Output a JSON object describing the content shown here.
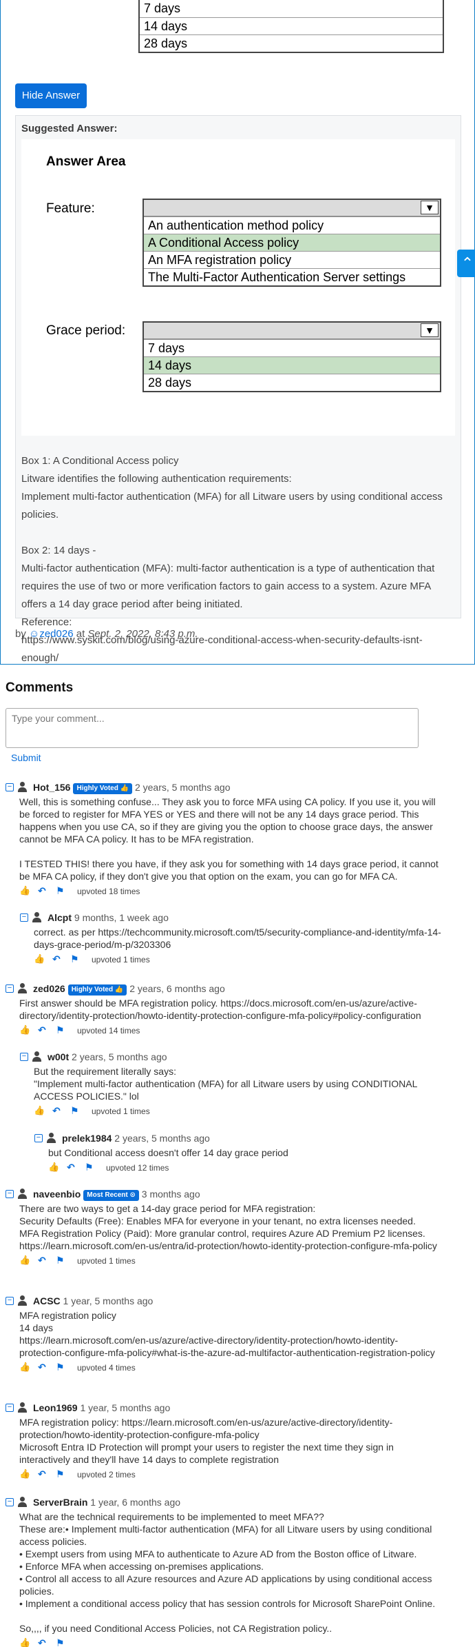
{
  "question": {
    "top_options": [
      "7 days",
      "14 days",
      "28 days"
    ],
    "hide_answer_label": "Hide Answer",
    "suggested_answer_label": "Suggested Answer:",
    "answer_area": {
      "title": "Answer Area",
      "feature_label": "Feature:",
      "feature_options": [
        "An authentication method policy",
        "A Conditional Access policy",
        "An MFA registration policy",
        "The Multi-Factor Authentication Server settings"
      ],
      "feature_selected": "A Conditional Access policy",
      "grace_label": "Grace period:",
      "grace_options": [
        "7 days",
        "14 days",
        "28 days"
      ],
      "grace_selected": "14 days"
    },
    "explanation": [
      "Box 1: A Conditional Access policy",
      "Litware identifies the following authentication requirements:",
      "Implement multi-factor authentication (MFA) for all Litware users by using conditional access policies.",
      "",
      "Box 2: 14 days -",
      "Multi-factor authentication (MFA): multi-factor authentication is a type of authentication that requires the use of two or more verification factors to gain access to a system. Azure MFA offers a 14 day grace period after being initiated.",
      "Reference:",
      "https://www.syskit.com/blog/using-azure-conditional-access-when-security-defaults-isnt-enough/"
    ],
    "byline": {
      "by": "by",
      "user": "zed026",
      "at": "at",
      "date": "Sept. 2, 2022, 8:43 p.m."
    }
  },
  "comments_section": {
    "heading": "Comments",
    "placeholder": "Type your comment...",
    "submit_label": "Submit"
  },
  "comments": [
    {
      "user": "Hot_156",
      "badge": "Highly Voted",
      "time": "2 years, 5 months ago",
      "body": [
        "Well, this is something confuse... They ask you to force MFA using CA policy. If you use it, you will be forced to register for MFA YES or YES and there will not be any 14 days grace period. This happens when you use CA, so if they are giving you the option to choose grace days, the answer cannot be MFA CA policy. It has to be MFA registration.",
        "",
        "I TESTED THIS! there you have, if they ask you for something with 14 days grace period, it cannot be MFA CA policy, if they don't give you that option on the exam, you can go for MFA CA."
      ],
      "upvoted": "upvoted 18 times"
    },
    {
      "user": "Alcpt",
      "badge": "",
      "time": "9 months, 1 week ago",
      "body": [
        "correct. as per https://techcommunity.microsoft.com/t5/security-compliance-and-identity/mfa-14-days-grace-period/m-p/3203306"
      ],
      "upvoted": "upvoted 1 times"
    },
    {
      "user": "zed026",
      "badge": "Highly Voted",
      "time": "2 years, 6 months ago",
      "body": [
        "First answer should be MFA registration policy. https://docs.microsoft.com/en-us/azure/active-directory/identity-protection/howto-identity-protection-configure-mfa-policy#policy-configuration"
      ],
      "upvoted": "upvoted 14 times"
    },
    {
      "user": "w00t",
      "badge": "",
      "time": "2 years, 5 months ago",
      "body": [
        "But the requirement literally says:",
        "\"Implement multi-factor authentication (MFA) for all Litware users by using CONDITIONAL ACCESS POLICIES.\" lol"
      ],
      "upvoted": "upvoted 1 times"
    },
    {
      "user": "prelek1984",
      "badge": "",
      "time": "2 years, 5 months ago",
      "body": [
        "but Conditional access doesn't offer 14 day grace period"
      ],
      "upvoted": "upvoted 12 times"
    },
    {
      "user": "naveenbio",
      "badge": "Most Recent",
      "time": "3 months ago",
      "body": [
        "There are two ways to get a 14-day grace period for MFA registration:",
        "Security Defaults (Free): Enables MFA for everyone in your tenant, no extra licenses needed.",
        "MFA Registration Policy (Paid): More granular control, requires Azure AD Premium P2 licenses.",
        "https://learn.microsoft.com/en-us/entra/id-protection/howto-identity-protection-configure-mfa-policy"
      ],
      "upvoted": "upvoted 1 times"
    },
    {
      "user": "ACSC",
      "badge": "",
      "time": "1 year, 5 months ago",
      "body": [
        "MFA registration policy",
        "14 days",
        "https://learn.microsoft.com/en-us/azure/active-directory/identity-protection/howto-identity-protection-configure-mfa-policy#what-is-the-azure-ad-multifactor-authentication-registration-policy"
      ],
      "upvoted": "upvoted 4 times"
    },
    {
      "user": "Leon1969",
      "badge": "",
      "time": "1 year, 5 months ago",
      "body": [
        "MFA registration policy: https://learn.microsoft.com/en-us/azure/active-directory/identity-protection/howto-identity-protection-configure-mfa-policy",
        "Microsoft Entra ID Protection will prompt your users to register the next time they sign in interactively and they'll have 14 days to complete registration"
      ],
      "upvoted": "upvoted 2 times"
    },
    {
      "user": "ServerBrain",
      "badge": "",
      "time": "1 year, 6 months ago",
      "body": [
        "What are the technical requirements to be implemented to meet MFA??",
        "These are:• Implement multi-factor authentication (MFA) for all Litware users by using conditional access policies.",
        "• Exempt users from using MFA to authenticate to Azure AD from the Boston office of Litware.",
        "• Enforce MFA when accessing on-premises applications.",
        "• Control all access to all Azure resources and Azure AD applications by using conditional access policies.",
        "• Implement a conditional access policy that has session controls for Microsoft SharePoint Online.",
        "",
        "So,,,, if you need Conditional Access Policies, not CA Registration policy.."
      ],
      "upvoted": ""
    }
  ]
}
